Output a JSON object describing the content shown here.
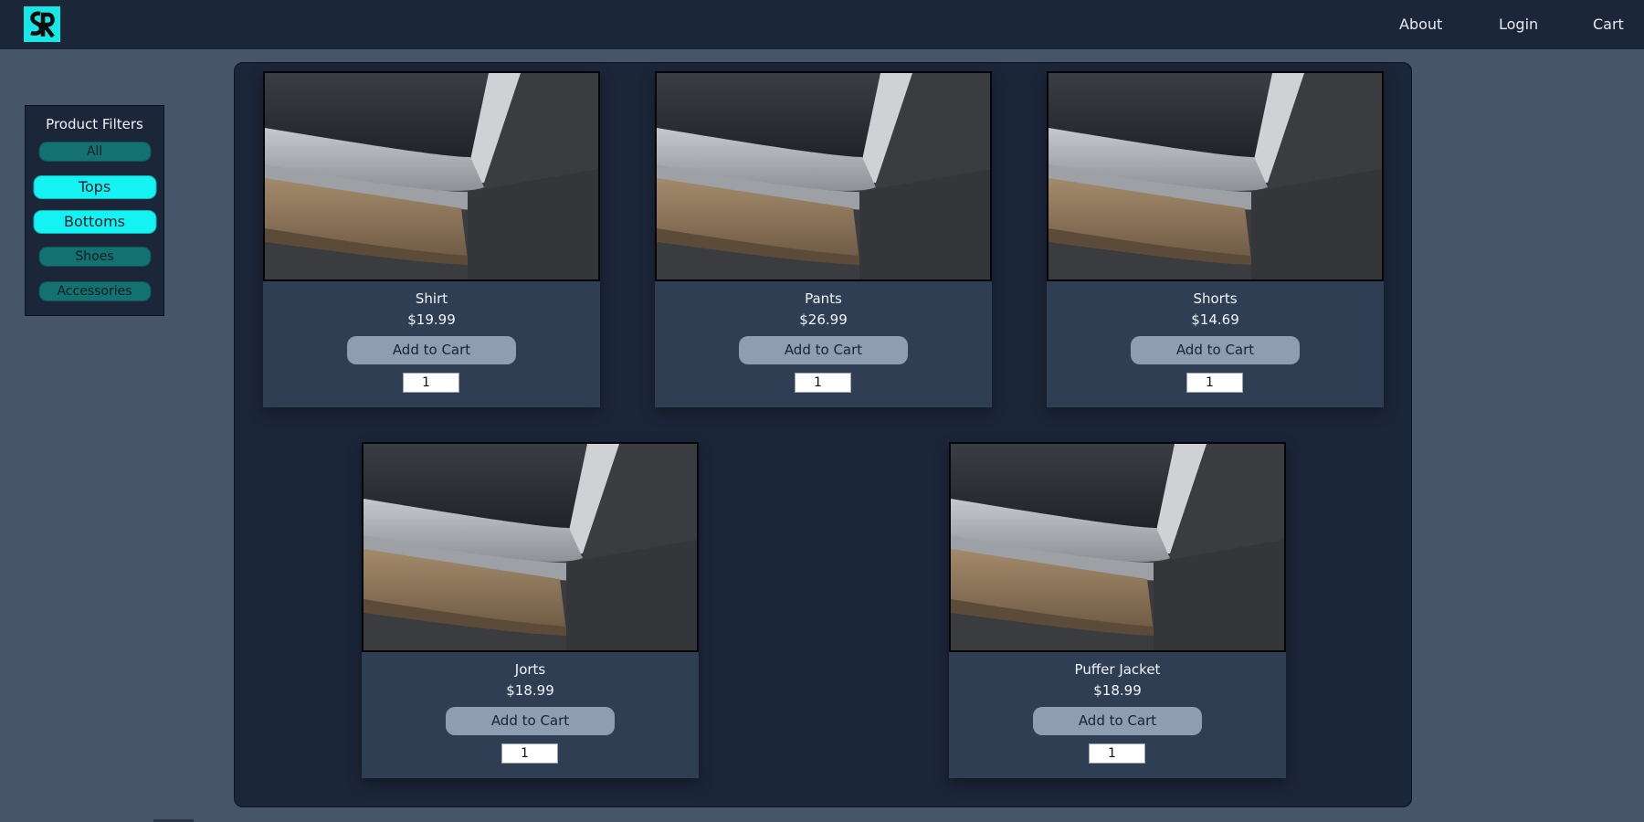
{
  "header": {
    "logo_icon": "sr-monogram-logo",
    "nav": [
      "About",
      "Login",
      "Cart"
    ]
  },
  "filters": {
    "title": "Product Filters",
    "items": [
      "All",
      "Tops",
      "Bottoms",
      "Shoes",
      "Accessories"
    ],
    "highlighted": [
      "Tops",
      "Bottoms"
    ]
  },
  "products": [
    {
      "name": "Shirt",
      "price": "$19.99",
      "button": "Add to Cart",
      "qty": "1"
    },
    {
      "name": "Pants",
      "price": "$26.99",
      "button": "Add to Cart",
      "qty": "1"
    },
    {
      "name": "Shorts",
      "price": "$14.69",
      "button": "Add to Cart",
      "qty": "1"
    },
    {
      "name": "Jorts",
      "price": "$18.99",
      "button": "Add to Cart",
      "qty": "1"
    },
    {
      "name": "Puffer Jacket",
      "price": "$18.99",
      "button": "Add to Cart",
      "qty": "1"
    }
  ],
  "colors": {
    "page_bg": "#465569",
    "header_bg": "#1c2639",
    "accent": "#15f2f4",
    "filter_dim": "#137171",
    "card_body": "#2f3e52",
    "button": "#8f9db3"
  }
}
